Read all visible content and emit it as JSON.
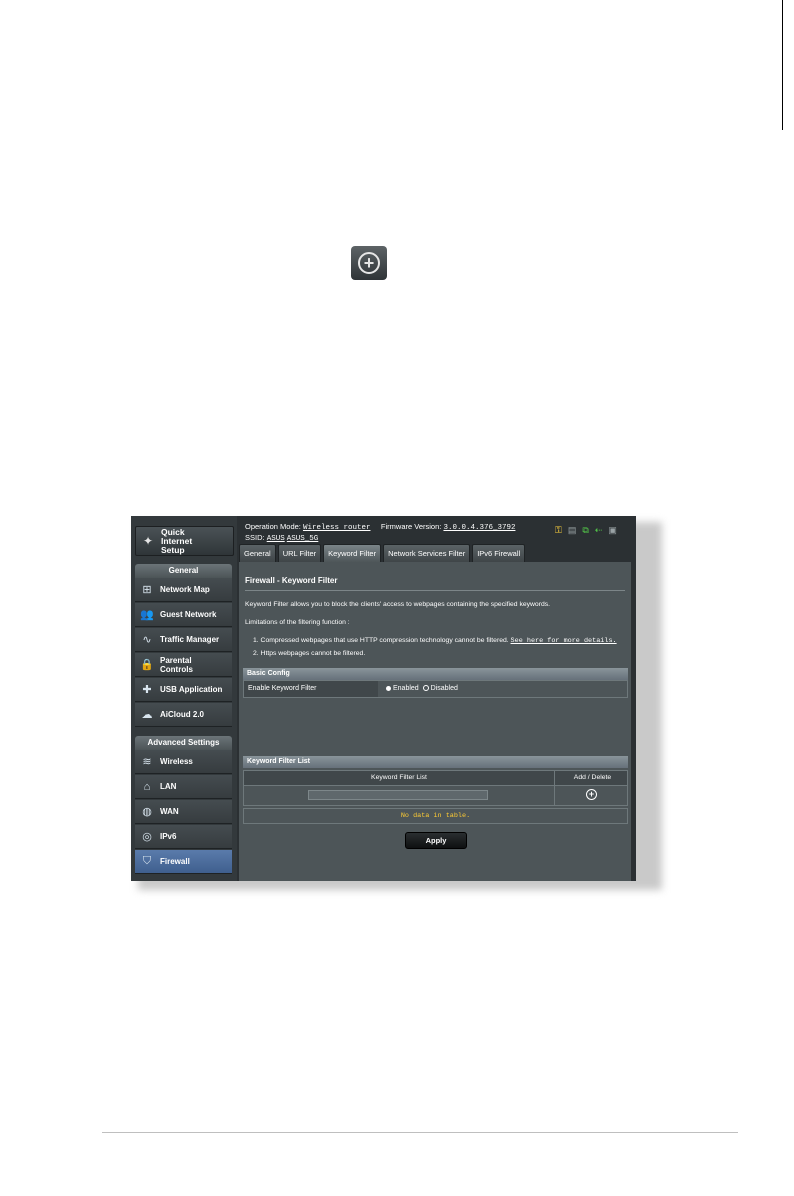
{
  "sidebar": {
    "quick_setup": "Quick Internet Setup",
    "general_header": "General",
    "general_items": [
      {
        "label": "Network Map",
        "icon": "network-map-icon"
      },
      {
        "label": "Guest Network",
        "icon": "guest-network-icon"
      },
      {
        "label": "Traffic Manager",
        "icon": "traffic-manager-icon"
      },
      {
        "label": "Parental Controls",
        "icon": "lock-icon"
      },
      {
        "label": "USB Application",
        "icon": "puzzle-icon"
      },
      {
        "label": "AiCloud 2.0",
        "icon": "cloud-icon"
      }
    ],
    "advanced_header": "Advanced Settings",
    "advanced_items": [
      {
        "label": "Wireless",
        "icon": "wifi-icon"
      },
      {
        "label": "LAN",
        "icon": "home-icon"
      },
      {
        "label": "WAN",
        "icon": "globe-icon"
      },
      {
        "label": "IPv6",
        "icon": "ipv6-icon"
      },
      {
        "label": "Firewall",
        "icon": "shield-icon"
      }
    ]
  },
  "top": {
    "operation_mode_label": "Operation Mode:",
    "operation_mode_value": "Wireless router",
    "firmware_label": "Firmware Version:",
    "firmware_value": "3.0.0.4.376_3792",
    "ssid_label": "SSID:",
    "ssid_1": "ASUS",
    "ssid_2": "ASUS_5G"
  },
  "tabs": [
    "General",
    "URL Filter",
    "Keyword Filter",
    "Network Services Filter",
    "IPv6 Firewall"
  ],
  "page": {
    "title": "Firewall - Keyword Filter",
    "description": "Keyword Filter allows you to block the clients' access to webpages containing the specified keywords.",
    "limitations_title": "Limitations of the filtering function :",
    "limitation_1": "1.  Compressed webpages that use HTTP compression technology cannot be filtered.",
    "limitation_1_link": "See here for more details.",
    "limitation_2": "2.  Https webpages cannot be filtered.",
    "basic_config_header": "Basic Config",
    "enable_label": "Enable Keyword Filter",
    "enabled_option": "Enabled",
    "disabled_option": "Disabled",
    "list_header": "Keyword Filter List",
    "col_list": "Keyword Filter List",
    "col_add_delete": "Add / Delete",
    "no_data": "No data in table.",
    "apply": "Apply"
  },
  "colors": {
    "accent_active": "#4f6f9e",
    "no_data_text": "#ffcc33"
  }
}
